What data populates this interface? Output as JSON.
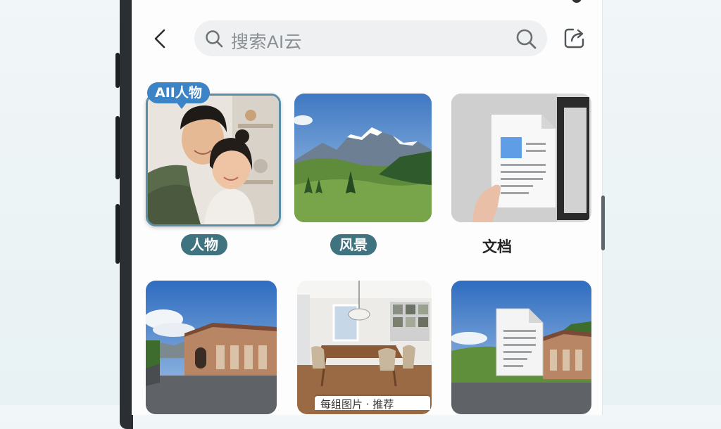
{
  "search": {
    "placeholder": "搜索AI云"
  },
  "icons": {
    "back": "chevron-left-icon",
    "search_lead": "search-icon",
    "search_trail": "search-icon",
    "share": "share-export-icon"
  },
  "categories": [
    {
      "label": "人物",
      "badge": "AII人物"
    },
    {
      "label": "风景"
    },
    {
      "label": "文档"
    }
  ],
  "grid_bottom_caption": "每组图片 · 推荐",
  "colors": {
    "pill": "#3f7380",
    "badge": "#3d84c6",
    "search_bg": "#eef0f1"
  }
}
